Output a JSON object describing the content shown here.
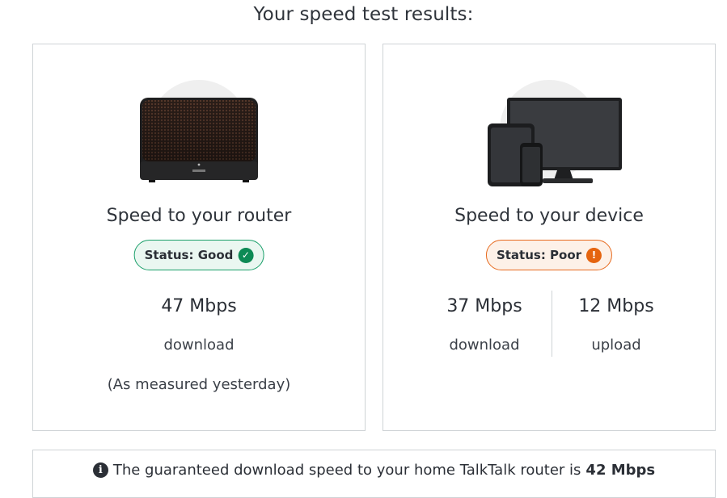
{
  "page": {
    "title": "Your speed test results:"
  },
  "router_card": {
    "heading": "Speed to your router",
    "status": {
      "label": "Status: Good",
      "state": "good",
      "icon": "check-icon",
      "color": "#0d8a55"
    },
    "download": {
      "value": "47 Mbps",
      "label": "download"
    },
    "note": "(As measured yesterday)",
    "image": "router-image"
  },
  "device_card": {
    "heading": "Speed to your device",
    "status": {
      "label": "Status: Poor",
      "state": "poor",
      "icon": "exclamation-icon",
      "color": "#e5640f"
    },
    "download": {
      "value": "37 Mbps",
      "label": "download"
    },
    "upload": {
      "value": "12 Mbps",
      "label": "upload"
    },
    "image": "devices-image"
  },
  "info": {
    "icon": "info-icon",
    "text": "The guaranteed download speed to your home TalkTalk router is",
    "highlight": "42 Mbps"
  }
}
